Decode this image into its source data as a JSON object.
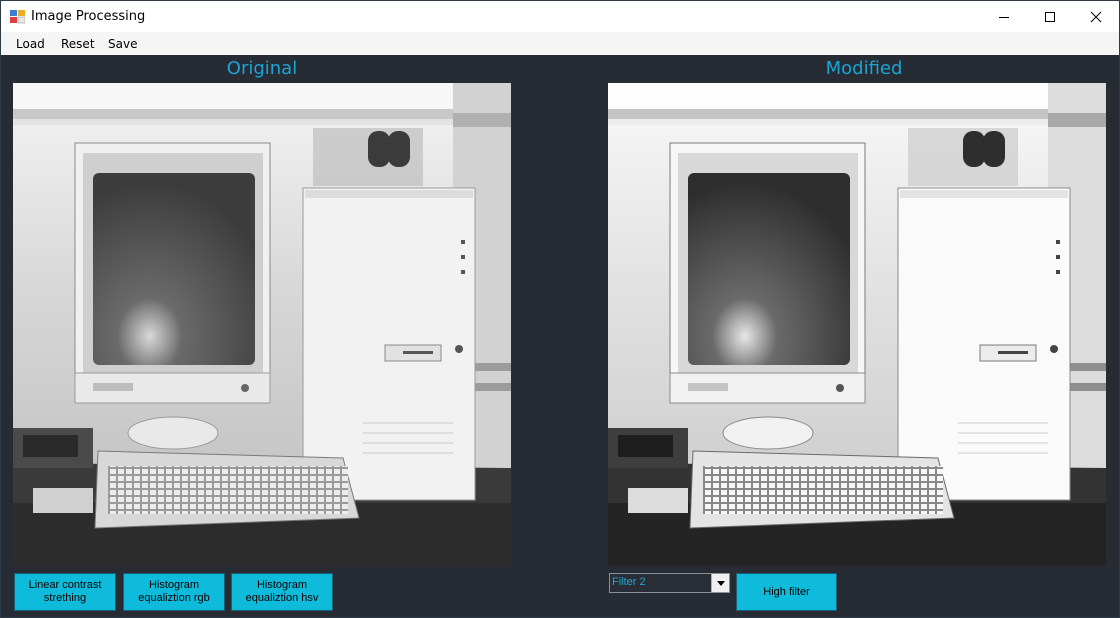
{
  "window": {
    "title": "Image Processing",
    "minimize_icon": "minimize-icon",
    "maximize_icon": "maximize-icon",
    "close_icon": "close-icon"
  },
  "menu": {
    "items": [
      "Load",
      "Reset",
      "Save"
    ]
  },
  "panels": {
    "original_label": "Original",
    "modified_label": "Modified"
  },
  "buttons": {
    "linear": "Linear contrast strething",
    "hist_rgb": "Histogram equaliztion rgb",
    "hist_hsv": "Histogram equaliztion hsv",
    "high_filter": "High filter"
  },
  "filter_select": {
    "value": "Filter 2"
  },
  "colors": {
    "background": "#262b34",
    "accent": "#1aa5d6",
    "button": "#0ebbdb"
  }
}
